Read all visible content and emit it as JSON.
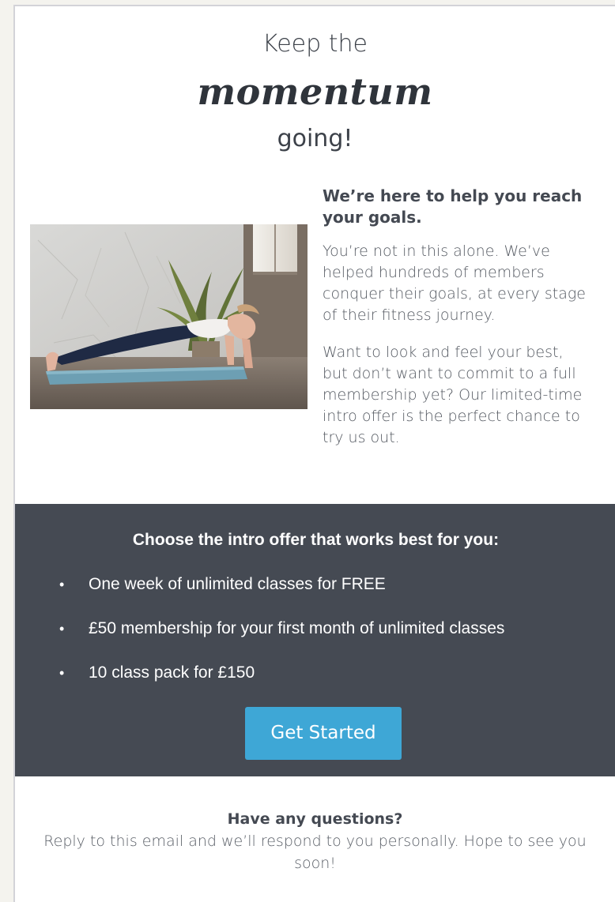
{
  "hero": {
    "line1": "Keep the",
    "line2": "momentum",
    "line3": "going!"
  },
  "intro": {
    "heading": "We’re here to help you reach your goals.",
    "paragraphs": [
      "You’re not in this alone. We’ve helped hundreds of members conquer their goals, at every stage of their fitness journey.",
      "Want to look and feel your best, but don’t want to commit to a full membership yet? Our limited-time intro offer is the perfect chance to try us out."
    ]
  },
  "offers": {
    "heading": "Choose the intro offer that works best for you:",
    "bullet": "•",
    "items": [
      "One week of unlimited classes for FREE",
      "£50 membership for your first month of unlimited classes",
      "10 class pack for £150"
    ],
    "cta_label": "Get Started"
  },
  "footer": {
    "heading": "Have any questions?",
    "text": "Reply to this email and we’ll respond to you personally. Hope to see you soon!"
  },
  "colors": {
    "page_background": "#f4f3ee",
    "card_background": "#ffffff",
    "offer_panel": "#454a53",
    "cta_button": "#3ea7d6",
    "heading_text": "#2f343b"
  },
  "icons": {
    "photo": "woman-doing-plank-photo"
  }
}
